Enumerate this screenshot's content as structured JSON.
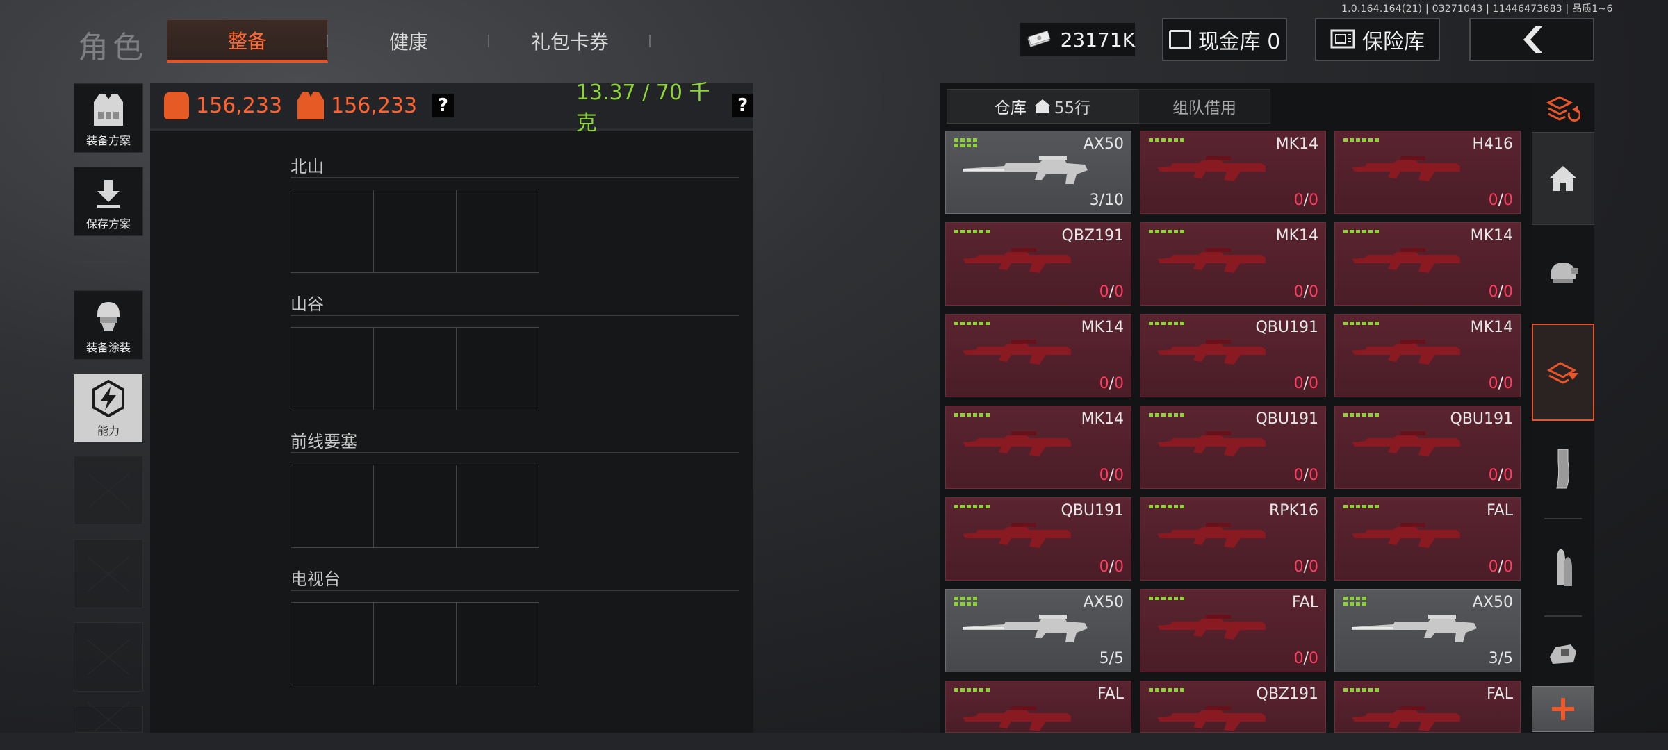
{
  "version": "1.0.164.164(21) | 03271043 | 11446473683 | 品质1~6",
  "header": {
    "title": "角色",
    "tabs": [
      {
        "label": "整备",
        "active": true
      },
      {
        "label": "健康",
        "active": false
      },
      {
        "label": "礼包卡券",
        "active": false
      }
    ],
    "currency": "23171K",
    "cash_vault_label": "现金库 0",
    "safe_label": "保险库",
    "accent": "#e0552b"
  },
  "left_sidebar": [
    {
      "label": "装备方案",
      "icon": "vest-icon"
    },
    {
      "label": "保存方案",
      "icon": "download-icon"
    },
    {
      "label": "装备涂装",
      "icon": "helmet-icon"
    },
    {
      "label": "能力",
      "icon": "lightning-icon"
    }
  ],
  "stats": {
    "backpack_value": "156,233",
    "vest_value": "156,233",
    "weight": "13.37 / 70 千克",
    "help": "?"
  },
  "maps": [
    {
      "name": "北山"
    },
    {
      "name": "山谷"
    },
    {
      "name": "前线要塞"
    },
    {
      "name": "电视台"
    }
  ],
  "warehouse": {
    "tab_label": "仓库",
    "rows_label": "55行",
    "team_borrow_label": "组队借用",
    "items": [
      {
        "name": "AX50",
        "cur": "3",
        "max": "10",
        "pips": 8,
        "style": "grey"
      },
      {
        "name": "MK14",
        "cur": "0",
        "max": "0",
        "pips": 6,
        "style": "red"
      },
      {
        "name": "H416",
        "cur": "0",
        "max": "0",
        "pips": 6,
        "style": "red"
      },
      {
        "name": "QBZ191",
        "cur": "0",
        "max": "0",
        "pips": 6,
        "style": "red"
      },
      {
        "name": "MK14",
        "cur": "0",
        "max": "0",
        "pips": 6,
        "style": "red"
      },
      {
        "name": "MK14",
        "cur": "0",
        "max": "0",
        "pips": 6,
        "style": "red"
      },
      {
        "name": "MK14",
        "cur": "0",
        "max": "0",
        "pips": 6,
        "style": "red"
      },
      {
        "name": "QBU191",
        "cur": "0",
        "max": "0",
        "pips": 6,
        "style": "red"
      },
      {
        "name": "MK14",
        "cur": "0",
        "max": "0",
        "pips": 6,
        "style": "red"
      },
      {
        "name": "MK14",
        "cur": "0",
        "max": "0",
        "pips": 6,
        "style": "red"
      },
      {
        "name": "QBU191",
        "cur": "0",
        "max": "0",
        "pips": 6,
        "style": "red"
      },
      {
        "name": "QBU191",
        "cur": "0",
        "max": "0",
        "pips": 6,
        "style": "red"
      },
      {
        "name": "QBU191",
        "cur": "0",
        "max": "0",
        "pips": 6,
        "style": "red"
      },
      {
        "name": "RPK16",
        "cur": "0",
        "max": "0",
        "pips": 6,
        "style": "red"
      },
      {
        "name": "FAL",
        "cur": "0",
        "max": "0",
        "pips": 6,
        "style": "red"
      },
      {
        "name": "AX50",
        "cur": "5",
        "max": "5",
        "pips": 8,
        "style": "grey"
      },
      {
        "name": "FAL",
        "cur": "0",
        "max": "0",
        "pips": 6,
        "style": "red"
      },
      {
        "name": "AX50",
        "cur": "3",
        "max": "5",
        "pips": 8,
        "style": "grey"
      },
      {
        "name": "FAL",
        "cur": "",
        "max": "",
        "pips": 6,
        "style": "red"
      },
      {
        "name": "QBZ191",
        "cur": "",
        "max": "",
        "pips": 6,
        "style": "red"
      },
      {
        "name": "FAL",
        "cur": "",
        "max": "",
        "pips": 6,
        "style": "red"
      }
    ]
  },
  "right_categories": [
    {
      "icon": "stack-refresh-icon"
    },
    {
      "icon": "home-icon"
    },
    {
      "icon": "helmet-icon"
    },
    {
      "icon": "rifle-icon",
      "selected": true
    },
    {
      "icon": "magazine-icon"
    },
    {
      "icon": "ammo-icon"
    },
    {
      "icon": "scope-icon"
    },
    {
      "icon": "plus-icon"
    }
  ]
}
